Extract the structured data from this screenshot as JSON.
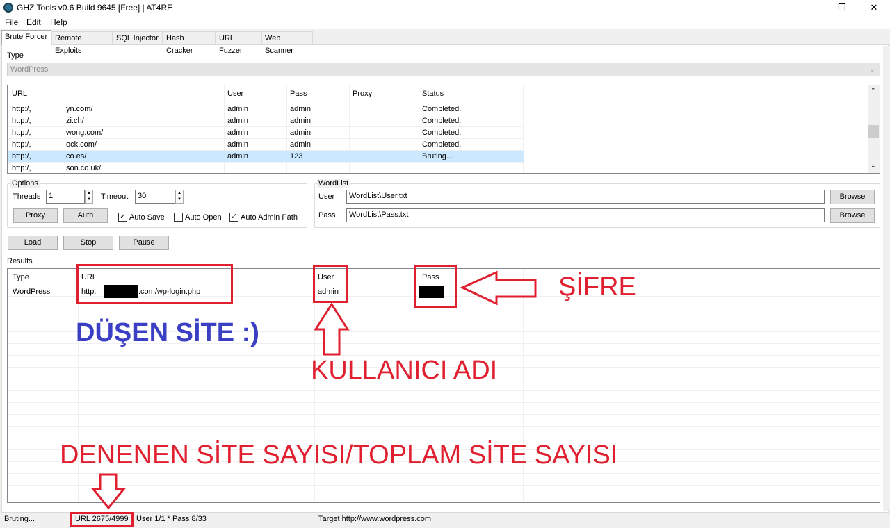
{
  "window": {
    "title": "GHZ Tools v0.6 Build 9645 [Free] | AT4RE",
    "minimize": "—",
    "maximize": "❐",
    "close": "✕"
  },
  "menu": [
    "File",
    "Edit",
    "Help"
  ],
  "tabs": [
    "Brute Forcer",
    "Remote Exploits",
    "SQL Injector",
    "Hash Cracker",
    "URL Fuzzer",
    "Web Scanner"
  ],
  "type": {
    "label": "Type",
    "value": "WordPress"
  },
  "url_list": {
    "columns": [
      "URL",
      "User",
      "Pass",
      "Proxy",
      "Status"
    ],
    "rows": [
      {
        "url_a": "http:/,",
        "url_b": "yn.com/",
        "user": "admin",
        "pass": "admin",
        "proxy": "",
        "status": "Completed."
      },
      {
        "url_a": "http:/,",
        "url_b": "zi.ch/",
        "user": "admin",
        "pass": "admin",
        "proxy": "",
        "status": "Completed."
      },
      {
        "url_a": "http:/,",
        "url_b": "wong.com/",
        "user": "admin",
        "pass": "admin",
        "proxy": "",
        "status": "Completed."
      },
      {
        "url_a": "http:/,",
        "url_b": "ock.com/",
        "user": "admin",
        "pass": "admin",
        "proxy": "",
        "status": "Completed."
      },
      {
        "url_a": "http:/,",
        "url_b": "co.es/",
        "user": "admin",
        "pass": "123",
        "proxy": "",
        "status": "Bruting..."
      },
      {
        "url_a": "http:/,",
        "url_b": "son.co.uk/",
        "user": "",
        "pass": "",
        "proxy": "",
        "status": ""
      }
    ],
    "selected_row": 4
  },
  "options": {
    "title": "Options",
    "threads_label": "Threads",
    "threads_value": "1",
    "timeout_label": "Timeout",
    "timeout_value": "30",
    "proxy_button": "Proxy",
    "auth_button": "Auth",
    "auto_save": {
      "label": "Auto Save",
      "checked": true
    },
    "auto_open": {
      "label": "Auto Open",
      "checked": false
    },
    "auto_admin_path": {
      "label": "Auto Admin Path",
      "checked": true
    }
  },
  "wordlist": {
    "title": "WordList",
    "user_label": "User",
    "user_value": "WordList\\User.txt",
    "pass_label": "Pass",
    "pass_value": "WordList\\Pass.txt",
    "browse": "Browse"
  },
  "actions": {
    "load": "Load",
    "stop": "Stop",
    "pause": "Pause"
  },
  "results": {
    "label": "Results",
    "columns": [
      "Type",
      "URL",
      "User",
      "Pass"
    ],
    "row": {
      "type": "WordPress",
      "url_a": "http:",
      "url_b": ".com/wp-login.php",
      "user": "admin"
    }
  },
  "status": {
    "state": "Bruting...",
    "url_count": "URL 2675/4999",
    "user_pass": "User 1/1 * Pass 8/33",
    "target": "Target http://www.wordpress.com"
  },
  "annotations": {
    "sifre": "ŞİFRE",
    "dusen_site": "DÜŞEN SİTE  :)",
    "kullanici_adi": "KULLANICI ADI",
    "denenen": "DENENEN SİTE SAYISI/TOPLAM SİTE SAYISI",
    "red": "#e02030",
    "blue": "#3a3fc4"
  }
}
